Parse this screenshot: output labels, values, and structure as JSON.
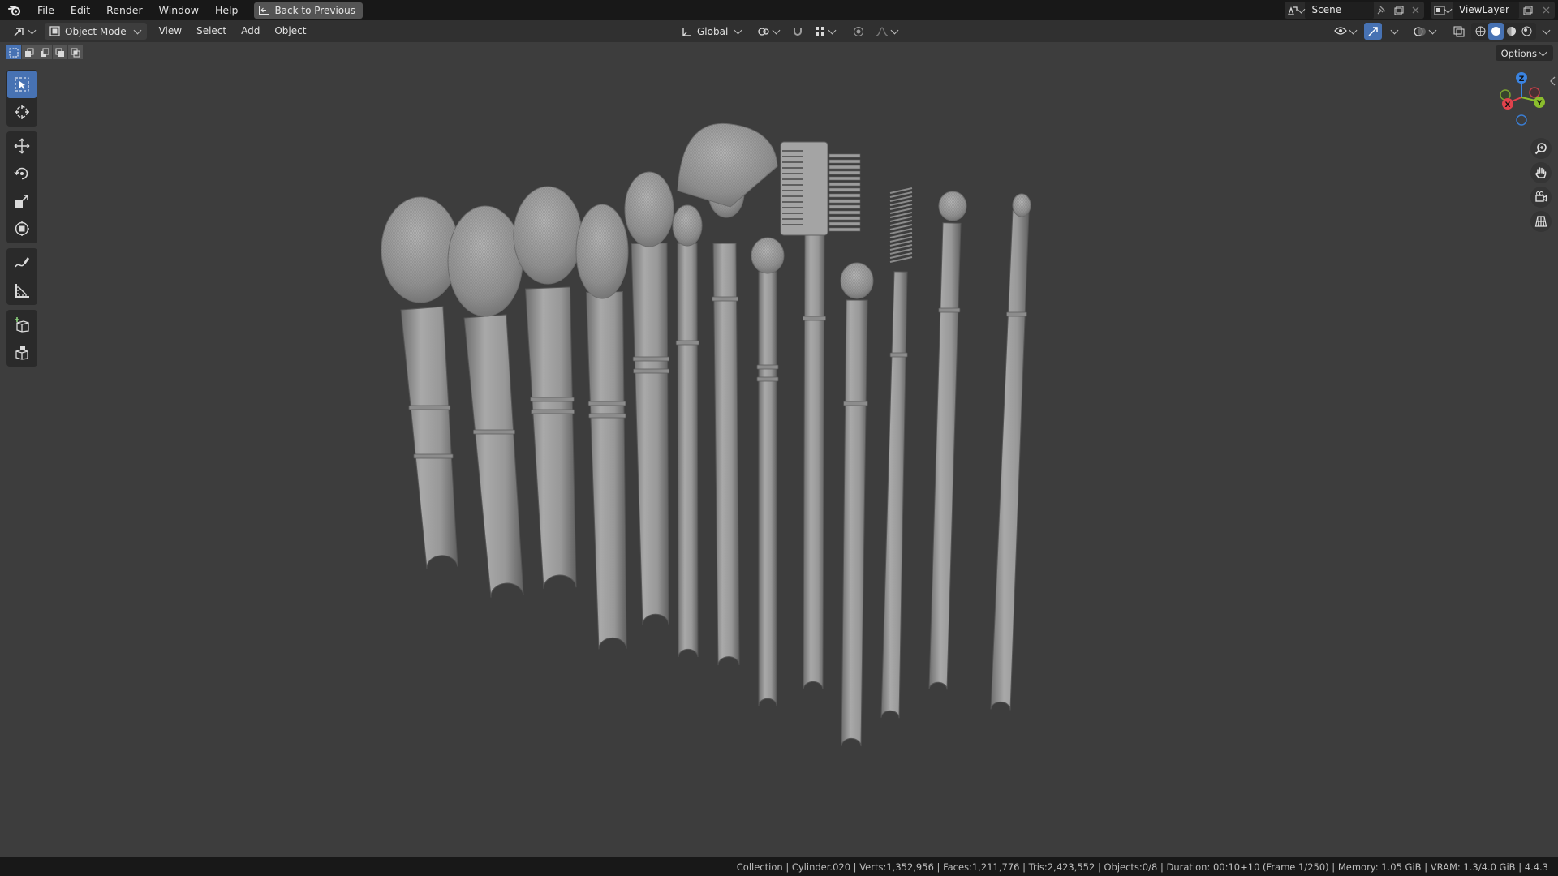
{
  "topbar": {
    "menus": [
      "File",
      "Edit",
      "Render",
      "Window",
      "Help"
    ],
    "back_button": "Back to Previous",
    "scene": "Scene",
    "view_layer": "ViewLayer"
  },
  "header": {
    "mode": "Object Mode",
    "menus": [
      "View",
      "Select",
      "Add",
      "Object"
    ],
    "orientation": "Global"
  },
  "viewport": {
    "options_label": "Options",
    "gizmo": {
      "x": "X",
      "y": "Y",
      "z": "Z"
    },
    "object_colors": {
      "background": "#3d3d3d",
      "mesh": "#9c9c9c"
    }
  },
  "toolbar": {
    "tools": [
      "select-box",
      "cursor",
      "move",
      "rotate",
      "scale",
      "transform",
      "annotate",
      "measure",
      "add-cube",
      "extrude"
    ]
  },
  "status": {
    "text": "Collection | Cylinder.020 | Verts:1,352,956 | Faces:1,211,776 | Tris:2,423,552 | Objects:0/8 | Duration: 00:10+10 (Frame 1/250) | Memory: 1.05 GiB | VRAM: 1.3/4.0 GiB | 4.4.3"
  },
  "colors": {
    "accent": "#4772b3",
    "x_axis": "#e0424c",
    "y_axis": "#8bbd2d",
    "z_axis": "#3a83e0"
  }
}
